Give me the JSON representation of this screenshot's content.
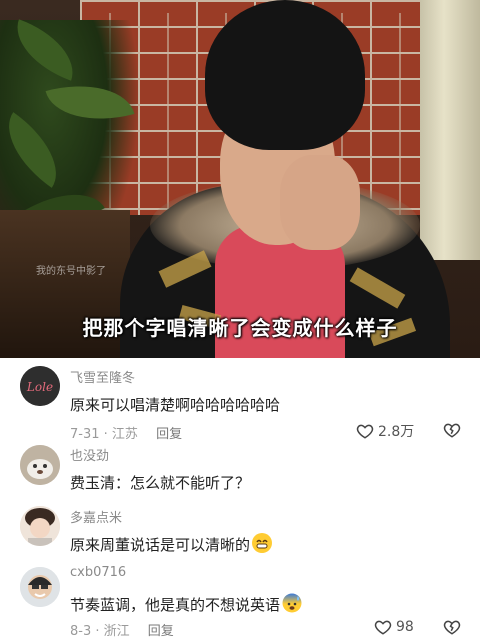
{
  "video": {
    "watermark": "我的东号中影了",
    "subtitle": "把那个字唱清晰了会变成什么样子"
  },
  "comments": [
    {
      "username": "飞雪至隆冬",
      "avatar_text": "Lole",
      "text": "原来可以唱清楚啊哈哈哈哈哈哈",
      "date": "7-31",
      "location": "江苏",
      "reply_label": "回复",
      "likes": "2.8万"
    },
    {
      "username": "也没劲",
      "text": "费玉清：怎么就不能听了？"
    },
    {
      "username": "多嘉点米",
      "text": "原来周董说话是可以清晰的",
      "emoji": "grinning-emoji"
    },
    {
      "username": "cxb0716",
      "text": "节奏蓝调，他是真的不想说英语",
      "emoji": "cold-sweat-emoji",
      "date": "8-3",
      "location": "浙江",
      "reply_label": "回复",
      "likes": "98"
    }
  ],
  "colors": {
    "subtitle": "#ffffff",
    "username": "#8a8a8a",
    "meta": "#9a9a9a"
  }
}
